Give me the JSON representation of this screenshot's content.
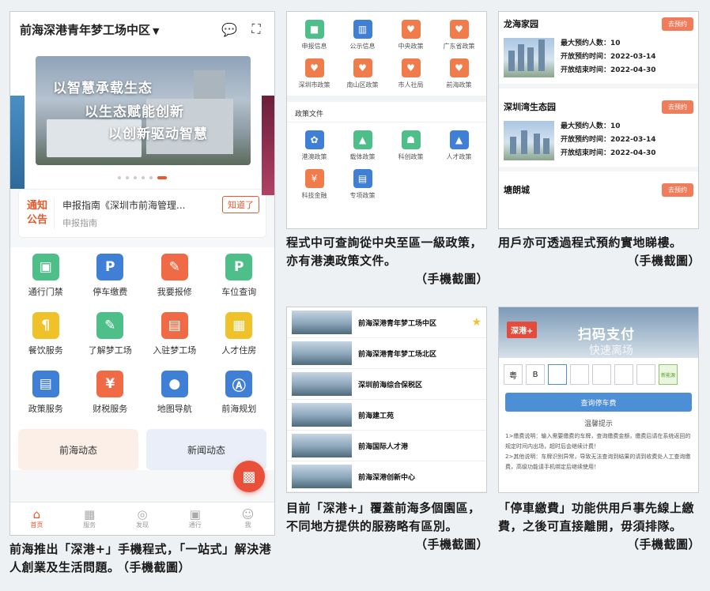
{
  "app": {
    "title": "前海深港青年梦工场中区",
    "banner_lines": [
      "以智慧承载生态",
      "以生态赋能创新",
      "以创新驱动智慧"
    ],
    "notice": {
      "tag": "通知公告",
      "line1": "申报指南《深圳市前海管理...",
      "line2": "申报指南",
      "button": "知道了"
    },
    "grid": [
      {
        "label": "通行门禁",
        "icon": "gate-icon",
        "glyph": "▣",
        "color": "#4fbf8a"
      },
      {
        "label": "停车缴费",
        "icon": "parking-icon",
        "glyph": "P",
        "color": "#3f7fd6"
      },
      {
        "label": "我要报修",
        "icon": "wrench-icon",
        "glyph": "✎",
        "color": "#ef6a45"
      },
      {
        "label": "车位查询",
        "icon": "parking-space-icon",
        "glyph": "P",
        "color": "#4fbf8a"
      },
      {
        "label": "餐饮服务",
        "icon": "dining-icon",
        "glyph": "¶",
        "color": "#f0c22a"
      },
      {
        "label": "了解梦工场",
        "icon": "document-icon",
        "glyph": "✎",
        "color": "#4fbf8a"
      },
      {
        "label": "入驻梦工场",
        "icon": "checkin-icon",
        "glyph": "▤",
        "color": "#ef6a45"
      },
      {
        "label": "人才住房",
        "icon": "building-icon",
        "glyph": "▦",
        "color": "#f0c22a"
      },
      {
        "label": "政策服务",
        "icon": "policy-icon",
        "glyph": "▤",
        "color": "#3f7fd6"
      },
      {
        "label": "财税服务",
        "icon": "tax-icon",
        "glyph": "¥",
        "color": "#ef6a45"
      },
      {
        "label": "地图导航",
        "icon": "map-pin-icon",
        "glyph": "●",
        "color": "#3f7fd6"
      },
      {
        "label": "前海规划",
        "icon": "planning-icon",
        "glyph": "Ⓐ",
        "color": "#3f7fd6"
      }
    ],
    "cards": [
      {
        "label": "前海动态",
        "bg": "#fbefe7"
      },
      {
        "label": "新闻动态",
        "bg": "#e9eef8"
      }
    ],
    "tabs": [
      {
        "label": "首页",
        "icon": "home-icon",
        "glyph": "⌂"
      },
      {
        "label": "服务",
        "icon": "grid-icon",
        "glyph": "▦"
      },
      {
        "label": "发现",
        "icon": "compass-icon",
        "glyph": "◎"
      },
      {
        "label": "通行",
        "icon": "gate-icon",
        "glyph": "▣"
      },
      {
        "label": "我",
        "icon": "user-icon",
        "glyph": "☺"
      }
    ],
    "qr_glyph": "▩"
  },
  "captions": {
    "c1": "前海推出「深港+」手機程式，「一站式」解決港人創業及生活問題。",
    "c2": "程式中可查詢從中央至區一級政策，亦有港澳政策文件。",
    "c3": "用戶亦可透過程式預約實地睇樓。",
    "c4": "目前「深港+」覆蓋前海多個園區，不同地方提供的服務略有區別。",
    "c5": "「停車繳費」功能供用戶事先線上繳費，之後可直接離開，毋須排隊。",
    "source": "（手機截圖）"
  },
  "policy": {
    "row1": [
      {
        "label": "申报信息",
        "icon": "bookmark-icon",
        "glyph": "■",
        "color": "#4fbf8a"
      },
      {
        "label": "公示信息",
        "icon": "book-icon",
        "glyph": "▥",
        "color": "#3f7fd6"
      },
      {
        "label": "中央政策",
        "icon": "heart-icon",
        "glyph": "♥",
        "color": "#ef7c4a"
      },
      {
        "label": "广东省政策",
        "icon": "heart-icon",
        "glyph": "♥",
        "color": "#ef7c4a"
      },
      {
        "label": "深圳市政策",
        "icon": "heart-icon",
        "glyph": "♥",
        "color": "#ef7c4a"
      },
      {
        "label": "南山区政策",
        "icon": "heart-icon",
        "glyph": "♥",
        "color": "#ef7c4a"
      },
      {
        "label": "市人社局",
        "icon": "heart-icon",
        "glyph": "♥",
        "color": "#ef7c4a"
      },
      {
        "label": "前海政策",
        "icon": "heart-icon",
        "glyph": "♥",
        "color": "#ef7c4a"
      }
    ],
    "section": "政策文件",
    "row2": [
      {
        "label": "港澳政策",
        "icon": "bauhinia-icon",
        "glyph": "✿",
        "color": "#3f7fd6"
      },
      {
        "label": "载体政策",
        "icon": "image-icon",
        "glyph": "▲",
        "color": "#4fbf8a"
      },
      {
        "label": "科创政策",
        "icon": "person-icon",
        "glyph": "☗",
        "color": "#4fbf8a"
      },
      {
        "label": "人才政策",
        "icon": "graduation-icon",
        "glyph": "▲",
        "color": "#3f7fd6"
      },
      {
        "label": "科技金融",
        "icon": "finance-icon",
        "glyph": "¥",
        "color": "#ef7c4a"
      },
      {
        "label": "专项政策",
        "icon": "document-icon",
        "glyph": "▤",
        "color": "#3f7fd6"
      }
    ]
  },
  "booking": {
    "button": "去预约",
    "projects": [
      {
        "name": "龙海家园",
        "max": "最大预约人数：10",
        "open": "开放预约时间：2022-03-14",
        "close": "开放结束时间：2022-04-30"
      },
      {
        "name": "深圳湾生态园",
        "max": "最大预约人数：10",
        "open": "开放预约时间：2022-03-14",
        "close": "开放结束时间：2022-04-30"
      },
      {
        "name": "塘朗城"
      }
    ]
  },
  "parks": [
    {
      "name": "前海深港青年梦工场中区",
      "starred": true
    },
    {
      "name": "前海深港青年梦工场北区",
      "starred": false
    },
    {
      "name": "深圳前海综合保税区",
      "starred": false
    },
    {
      "name": "前海建工苑",
      "starred": false
    },
    {
      "name": "前海国际人才港",
      "starred": false
    },
    {
      "name": "前海深港创新中心",
      "starred": false
    }
  ],
  "parking": {
    "logo": "深港+",
    "title": "扫码支付",
    "subtitle": "快速离场",
    "plate": [
      "粤",
      "B",
      "",
      "",
      "",
      "",
      "",
      "新能源"
    ],
    "query_button": "查询停车费",
    "tips_title": "温馨提示",
    "tips": [
      "1>缴费说明：输入需要缴费的车牌，查询缴费金额，缴费后请在系统返回的规定时间内出场，超时后会继续计费！",
      "2>其他说明：车牌识别异常，导致无法查询到结果的请到收费处人工查询缴费，高级功能请手机绑定后继续使用！"
    ]
  }
}
